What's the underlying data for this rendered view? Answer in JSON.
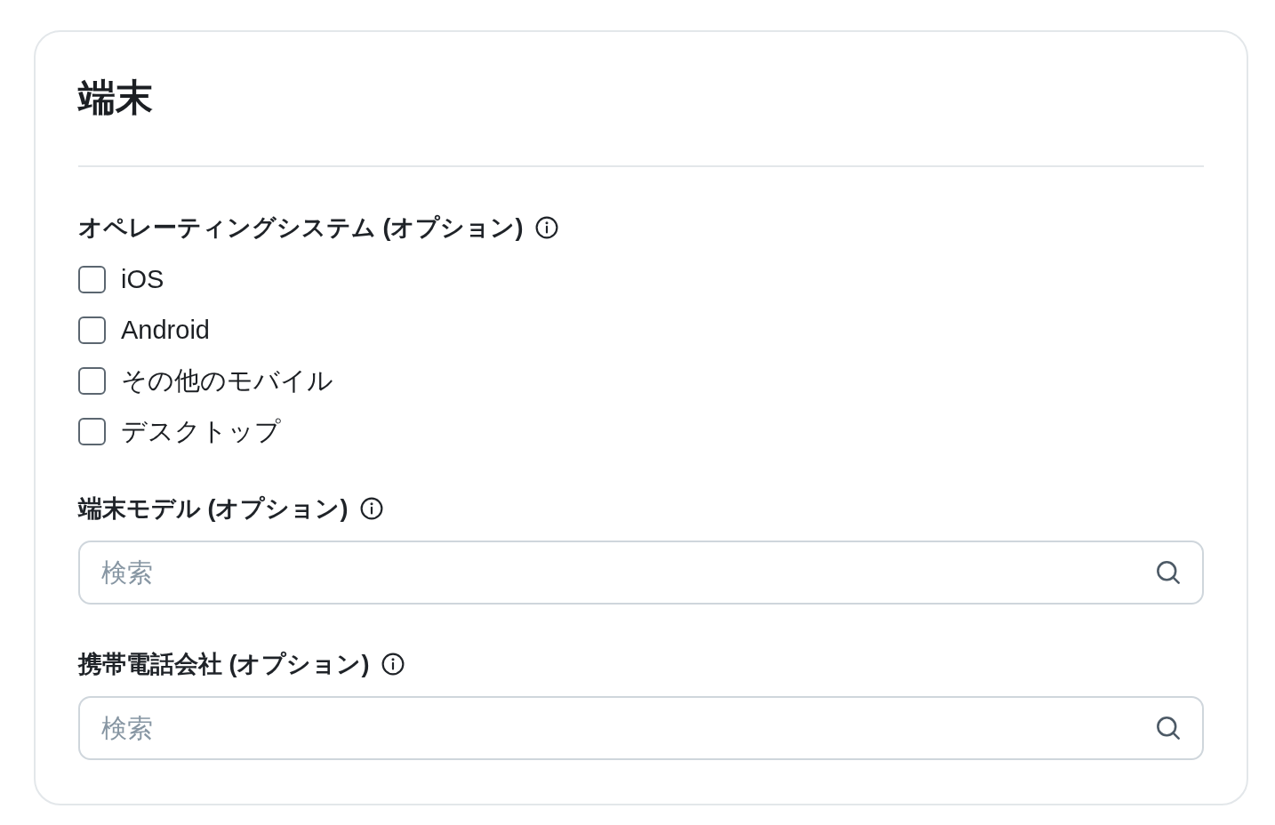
{
  "card": {
    "title": "端末",
    "sections": [
      {
        "kind": "checkboxes",
        "label": "オペレーティングシステム (オプション)",
        "options": [
          {
            "label": "iOS",
            "checked": false
          },
          {
            "label": "Android",
            "checked": false
          },
          {
            "label": "その他のモバイル",
            "checked": false
          },
          {
            "label": "デスクトップ",
            "checked": false
          }
        ]
      },
      {
        "kind": "search",
        "label": "端末モデル (オプション)",
        "placeholder": "検索"
      },
      {
        "kind": "search",
        "label": "携帯電話会社 (オプション)",
        "placeholder": "検索"
      }
    ]
  }
}
